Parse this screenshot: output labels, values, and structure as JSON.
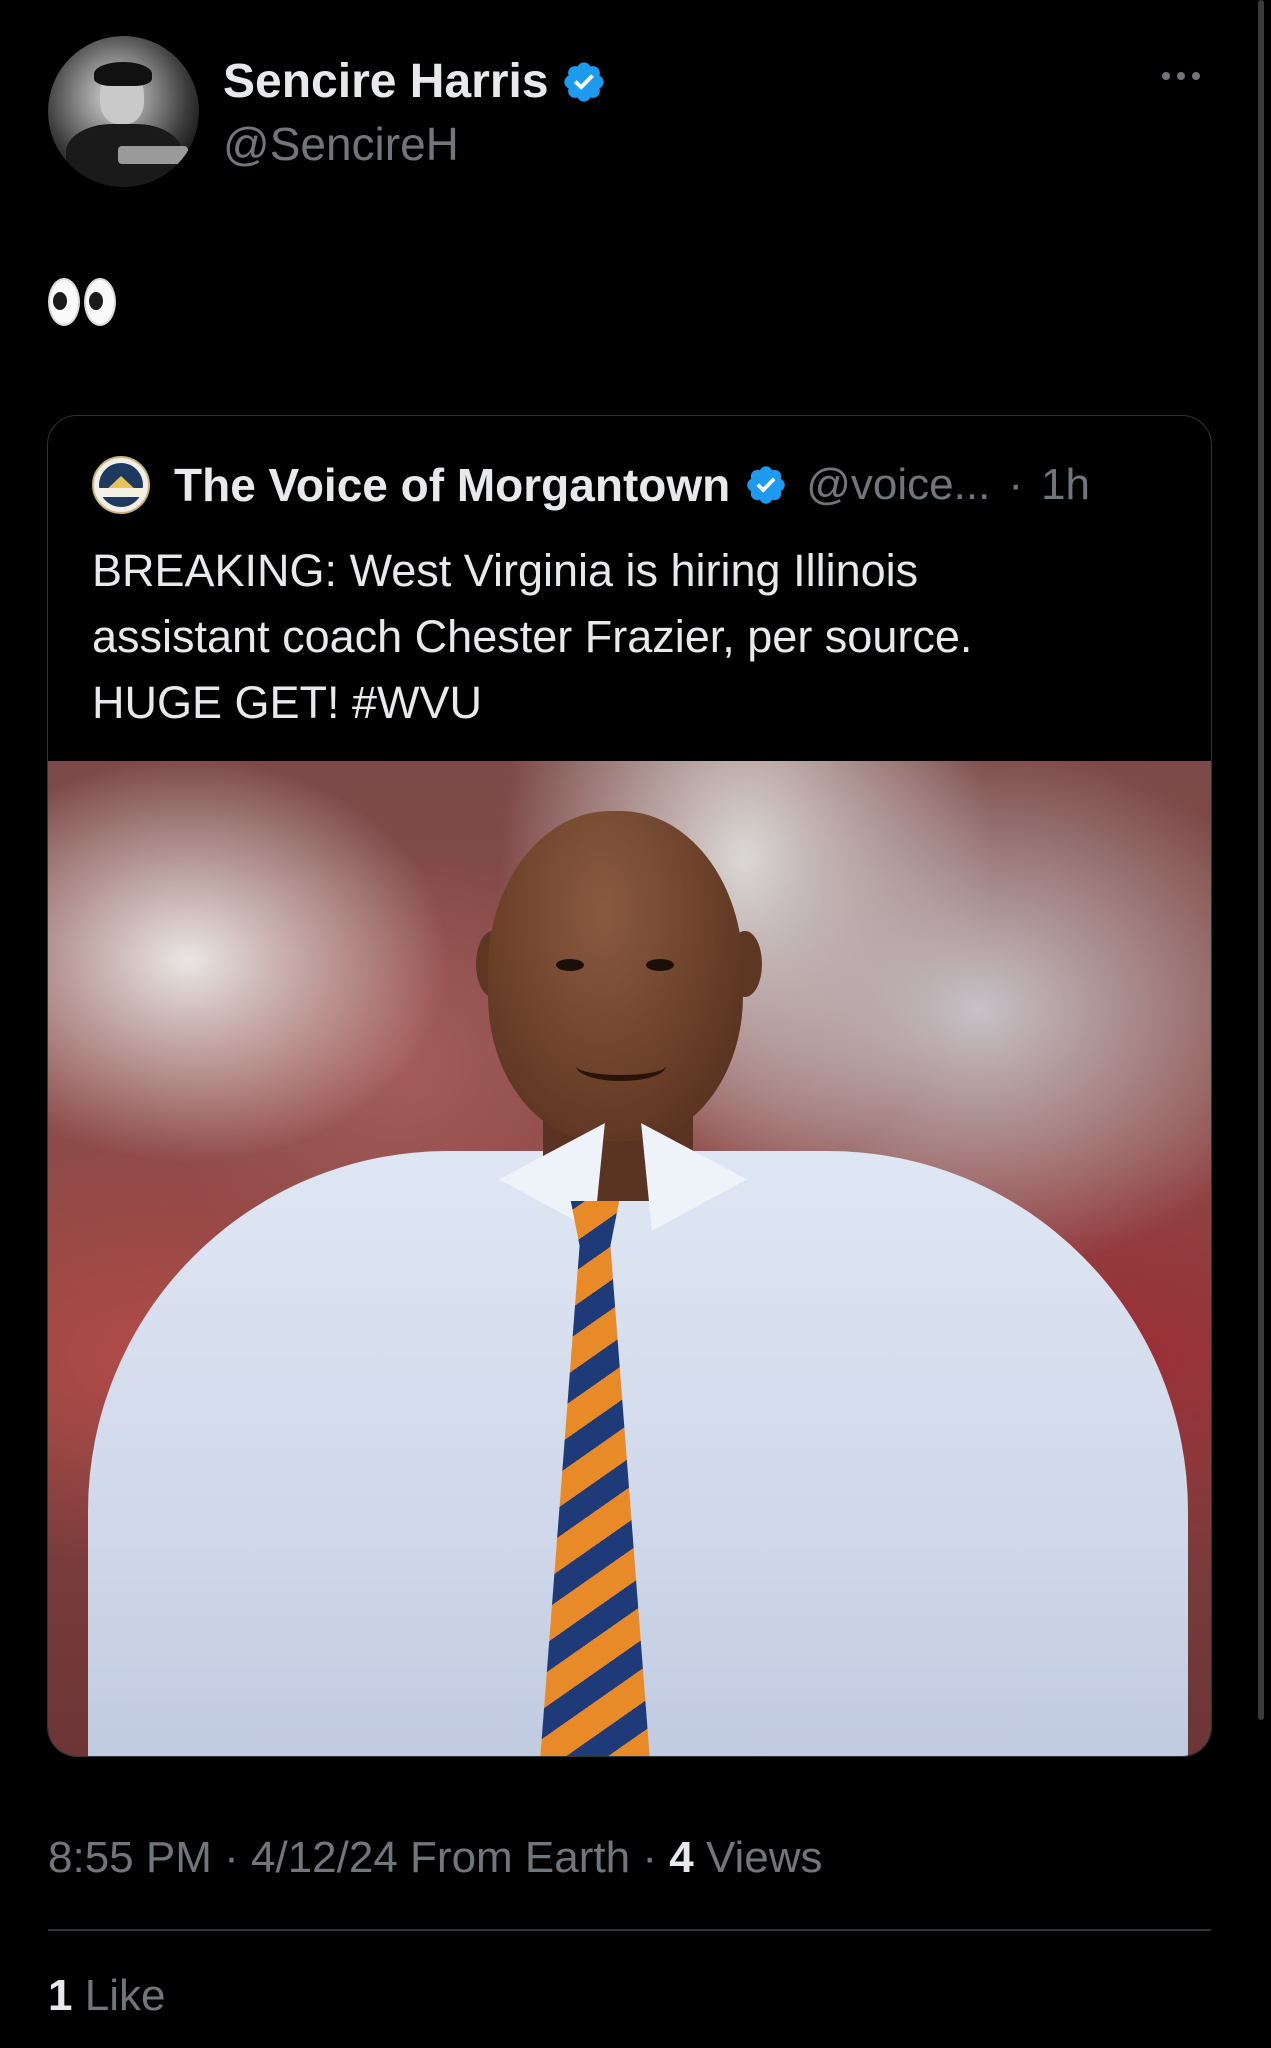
{
  "author": {
    "display_name": "Sencire Harris",
    "handle": "@SencireH",
    "avatar_icon": "profile-photo",
    "verified_color": "#1d9bf0"
  },
  "tweet": {
    "text_emoji": "eyes-emoji"
  },
  "quoted": {
    "display_name": "The Voice of Morgantown",
    "handle": "@voice...",
    "separator": "·",
    "time": "1h",
    "avatar_icon": "vom-logo",
    "avatar_logo_text": "VOM",
    "lines": [
      "BREAKING: West Virginia is hiring Illinois",
      "assistant coach Chester Frazier, per source.",
      "HUGE GET! #WVU"
    ],
    "image_icon": "coach-photo"
  },
  "meta": {
    "time": "8:55 PM",
    "sep1": "·",
    "date": "4/12/24",
    "source": "From Earth",
    "sep2": "·",
    "views_count": "4",
    "views_label": "Views"
  },
  "engagement": {
    "likes_count": "1",
    "likes_label": "Like"
  },
  "colors": {
    "background": "#000000",
    "primary_text": "#e7e9ea",
    "secondary_text": "#71767b",
    "border": "#2f3336",
    "verified": "#1d9bf0"
  }
}
